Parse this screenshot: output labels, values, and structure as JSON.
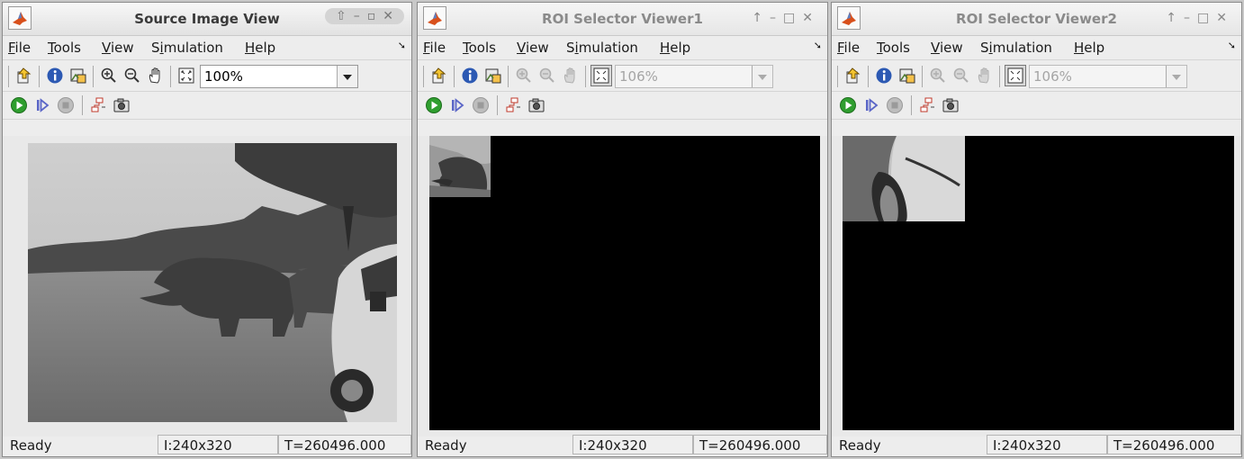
{
  "menu": {
    "items": [
      "File",
      "Tools",
      "View",
      "Simulation",
      "Help"
    ],
    "mnemonics": [
      "F",
      "T",
      "V",
      "i",
      "H"
    ]
  },
  "windows": [
    {
      "title": "Source Image View",
      "zoom": "100%",
      "status": {
        "ready": "Ready",
        "size": "I:240x320",
        "time": "T=260496.000"
      }
    },
    {
      "title": "ROI Selector Viewer1",
      "zoom": "106%",
      "status": {
        "ready": "Ready",
        "size": "I:240x320",
        "time": "T=260496.000"
      }
    },
    {
      "title": "ROI Selector Viewer2",
      "zoom": "106%",
      "status": {
        "ready": "Ready",
        "size": "I:240x320",
        "time": "T=260496.000"
      }
    }
  ],
  "toolbar_icons": [
    "export-icon",
    "info-icon",
    "pixel-region-icon",
    "zoom-in-icon",
    "zoom-out-icon",
    "pan-icon",
    "fit-to-window-icon"
  ],
  "playback_icons": [
    "play-icon",
    "step-forward-icon",
    "stop-icon",
    "highlight-block-icon",
    "snapshot-icon"
  ],
  "images": [
    "rhino-on-road-scene",
    "rhino-head-crop",
    "car-door-crop"
  ],
  "colors": {
    "background": "#ededed",
    "canvas": "#000000",
    "play_green": "#2f9e2f"
  }
}
